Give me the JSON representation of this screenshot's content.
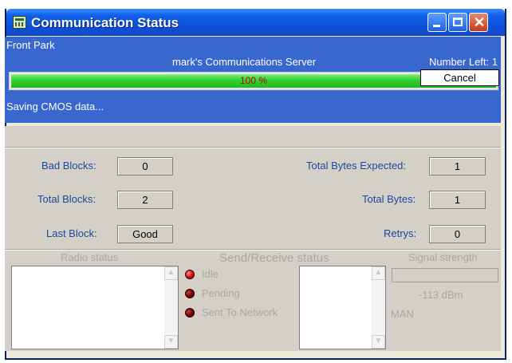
{
  "window": {
    "title": "Communication Status",
    "icons": {
      "app": "app-icon",
      "minimize": "minimize-icon",
      "maximize": "maximize-icon",
      "close": "close-icon"
    }
  },
  "header": {
    "location": "Front Park",
    "server": "mark's Communications Server",
    "number_left": "Number Left: 1",
    "progress_text": "100 %",
    "progress": 1.0,
    "status": "Saving CMOS data...",
    "cancel_label": "Cancel"
  },
  "stats": {
    "bad_blocks_label": "Bad Blocks:",
    "bad_blocks": "0",
    "total_blocks_label": "Total Blocks:",
    "total_blocks": "2",
    "last_block_label": "Last Block:",
    "last_block": "Good",
    "total_bytes_expected_label": "Total Bytes Expected:",
    "total_bytes_expected": "1",
    "total_bytes_label": "Total Bytes:",
    "total_bytes": "1",
    "retrys_label": "Retrys:",
    "retrys": "0"
  },
  "lower": {
    "radio_status_label": "Radio status",
    "send_receive_label": "Send/Receive status",
    "signal_strength_label": "Signal strength",
    "indicators": [
      {
        "label": "Idle",
        "color": "#e01010"
      },
      {
        "label": "Pending",
        "color": "#6a0000"
      },
      {
        "label": "Sent To Network",
        "color": "#6a0000"
      }
    ],
    "signal_dbm": "-113 dBm",
    "mode": "MAN"
  },
  "colors": {
    "title_bar": "#0b4fd6",
    "panel_blue": "#3767cf",
    "progress_green": "#2fd12f",
    "label_blue": "#1a4a9b"
  }
}
